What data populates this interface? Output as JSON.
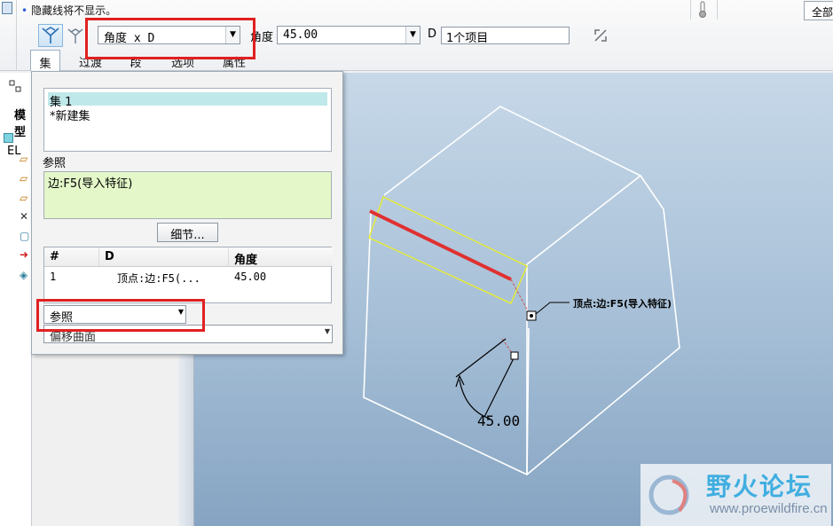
{
  "ribbon": {
    "message": "隐藏线将不显示。",
    "full_button": "全部",
    "mode_combo": "角度 x D",
    "angle_label": "角度",
    "angle_value": "45.00",
    "d_label": "D",
    "d_value": "1个项目"
  },
  "tabs": [
    {
      "label": "集"
    },
    {
      "label": "过渡"
    },
    {
      "label": "段"
    },
    {
      "label": "选项"
    },
    {
      "label": "属性"
    }
  ],
  "tree": {
    "tab_label": "模型",
    "root": "EL"
  },
  "panel": {
    "sets": [
      "集 1",
      "*新建集"
    ],
    "ref_label": "参照",
    "ref_value": "边:F5(导入特征)",
    "detail_button": "细节...",
    "table": {
      "headers": [
        "#",
        "D",
        "角度"
      ],
      "rows": [
        [
          "1",
          "顶点:边:F5(...",
          "45.00"
        ]
      ]
    },
    "ref_combo": "参照",
    "offset_combo": "偏移曲面"
  },
  "viewport": {
    "annotation": "顶点:边:F5(导入特征)",
    "dimension": "45.00"
  },
  "watermark": {
    "title": "野火论坛",
    "url": "www.proewildfire.cn"
  },
  "colors": {
    "highlight_edge": "#e03030",
    "selection_box": "#e8ec30",
    "callout_box": "#e02020"
  }
}
